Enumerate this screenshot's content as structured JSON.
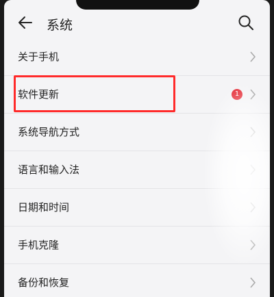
{
  "header": {
    "title": "系统",
    "back_icon": "back-arrow-icon",
    "search_icon": "search-icon"
  },
  "items": [
    {
      "label": "关于手机"
    },
    {
      "label": "软件更新",
      "badge": "1"
    },
    {
      "label": "系统导航方式"
    },
    {
      "label": "语言和输入法"
    },
    {
      "label": "日期和时间"
    },
    {
      "label": "手机克隆"
    },
    {
      "label": "备份和恢复"
    }
  ],
  "colors": {
    "highlight": "#ff2a2a",
    "badge": "#e5323c"
  }
}
